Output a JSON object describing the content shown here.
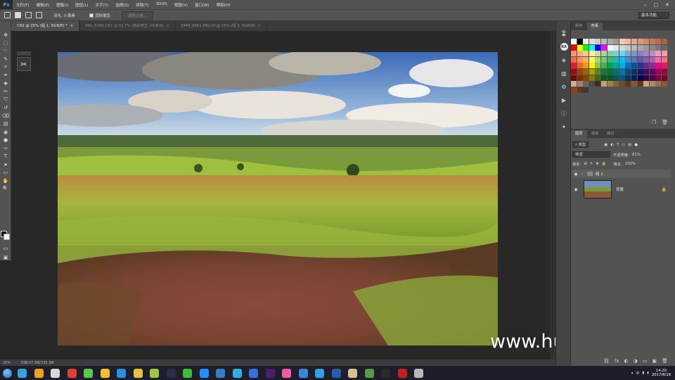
{
  "app": {
    "logo": "Ps"
  },
  "menu": [
    "文件(F)",
    "编辑(E)",
    "图像(I)",
    "图层(L)",
    "文字(Y)",
    "选择(S)",
    "滤镜(T)",
    "3D(D)",
    "视图(V)",
    "窗口(W)",
    "帮助(H)"
  ],
  "window_controls": [
    "–",
    "□",
    "✕"
  ],
  "options": {
    "feather_label": "羽化: 0 像素",
    "antialias_label": "消除锯齿",
    "refine_edge_label": "调整边缘...",
    "workspace": "基本功能"
  },
  "tabs": [
    {
      "label": "CR2 @ 25% (组 1, RGB/8) *",
      "active": true
    },
    {
      "label": "IMG_8399.CR2 @ 33.7% (色彩校正, RGB/8)",
      "active": false
    },
    {
      "label": "DMN_9981.HR2.tif @ 25% (组 1, RGB/8)",
      "active": false
    }
  ],
  "tool_icons": [
    "move-icon",
    "marquee-icon",
    "lasso-icon",
    "quick-select-icon",
    "crop-icon",
    "eyedropper-icon",
    "healing-icon",
    "brush-icon",
    "stamp-icon",
    "history-brush-icon",
    "eraser-icon",
    "gradient-icon",
    "blur-icon",
    "dodge-icon",
    "pen-icon",
    "type-icon",
    "path-select-icon",
    "shape-icon",
    "hand-icon",
    "zoom-icon"
  ],
  "tool_glyphs": [
    "✥",
    "⬚",
    "➰",
    "✎",
    "⌗",
    "✒",
    "✚",
    "✏",
    "⛉",
    "↺",
    "⌫",
    "▤",
    "◉",
    "●",
    "✑",
    "T",
    "➤",
    "▭",
    "✋",
    "🔍"
  ],
  "status": {
    "zoom": "25%",
    "doc": "文档:47.5M/233.3M"
  },
  "watermark": "www.hunls.com",
  "right_strip_icons": [
    "history-icon",
    "ra-icon",
    "properties-icon",
    "libraries-icon",
    "adjust-icon",
    "actions-icon",
    "info-icon",
    "color-sampler-icon"
  ],
  "right_strip_glyphs": [
    "⌛",
    "RA",
    "◈",
    "▥",
    "⚙",
    "▶",
    "ⓘ",
    "✦"
  ],
  "color_panel_tabs": [
    {
      "label": "颜色",
      "active": false
    },
    {
      "label": "色板",
      "active": true
    }
  ],
  "swatch_colors": [
    "#ffffff",
    "#000000",
    "#eeeeee",
    "#dddddd",
    "#cccccc",
    "#bbbbbb",
    "#aaaaaa",
    "#999999",
    "#f2c7b4",
    "#e8b9a0",
    "#dfa98c",
    "#d89a7a",
    "#cf8a68",
    "#c37b58",
    "#b76e4b",
    "#a8623f",
    "#ff0000",
    "#ffff00",
    "#00ff00",
    "#00ffff",
    "#0000ff",
    "#ff00ff",
    "#f5f5f5",
    "#e6e6e6",
    "#d6d6d6",
    "#c8c8c8",
    "#b8b8b8",
    "#a8a8a8",
    "#989898",
    "#888888",
    "#787878",
    "#686868",
    "#f7977a",
    "#f9ad81",
    "#fdc68a",
    "#fff79a",
    "#c4df9b",
    "#a2d39c",
    "#82ca9d",
    "#7bcdc8",
    "#6ecff6",
    "#7ea7d8",
    "#8493ca",
    "#8882be",
    "#a187be",
    "#bc8dbf",
    "#f49ac2",
    "#f6989d",
    "#f26c4f",
    "#f68e55",
    "#fbaf5c",
    "#fff467",
    "#acd372",
    "#7cc576",
    "#3bb878",
    "#1abbb4",
    "#00bff3",
    "#438ccb",
    "#5574b9",
    "#605ca8",
    "#855fa8",
    "#a763a8",
    "#f06ea9",
    "#f26d7d",
    "#ed1c24",
    "#f26522",
    "#f7941d",
    "#fff200",
    "#8dc73f",
    "#39b54a",
    "#00a651",
    "#00a99d",
    "#00aeef",
    "#0072bc",
    "#0054a6",
    "#2e3192",
    "#662d91",
    "#92278f",
    "#ec008c",
    "#ed145b",
    "#9e0b0f",
    "#a0410d",
    "#a36209",
    "#aba000",
    "#598527",
    "#1a7b30",
    "#007236",
    "#00746b",
    "#0076a3",
    "#004b80",
    "#003471",
    "#1b1464",
    "#440e62",
    "#630460",
    "#9e005d",
    "#9e0039",
    "#790000",
    "#7b2e00",
    "#7d4900",
    "#827b00",
    "#406618",
    "#005e20",
    "#005826",
    "#005952",
    "#005b7f",
    "#003663",
    "#002157",
    "#0d004c",
    "#32004b",
    "#4b0049",
    "#7b0046",
    "#7a0026",
    "#c7b299",
    "#998675",
    "#736357",
    "#534741",
    "#37302d",
    "#c69c6d",
    "#a67c52",
    "#8c6239",
    "#754c24",
    "#603913",
    "#8b5a2b",
    "#5e3c1a",
    "#cda97a",
    "#b08a5a",
    "#96724a",
    "#7e5c38",
    "#8b4513",
    "#6b3410",
    "#3a3a3a",
    "#535353",
    "#535353",
    "#535353",
    "#535353",
    "#535353",
    "#535353",
    "#535353",
    "#535353",
    "#535353",
    "#535353",
    "#535353",
    "#535353",
    "#535353"
  ],
  "layers_panel_tabs": [
    {
      "label": "图层",
      "active": true
    },
    {
      "label": "通道",
      "active": false
    },
    {
      "label": "路径",
      "active": false
    }
  ],
  "layers_controls": {
    "filter_kind": "类型",
    "blend_mode": "穿透",
    "opacity_label": "不透明度:",
    "opacity_value": "61%",
    "lock_label": "锁定:",
    "fill_label": "填充:",
    "fill_value": "100%"
  },
  "layers": [
    {
      "name": "组 1",
      "type": "group"
    },
    {
      "name": "背景",
      "type": "image",
      "locked": true
    }
  ],
  "layers_footer_icons": [
    "link-icon",
    "fx-icon",
    "mask-icon",
    "adjustment-icon",
    "group-icon",
    "new-layer-icon",
    "trash-icon"
  ],
  "layers_footer_glyphs": [
    "⛓",
    "fx",
    "◐",
    "◑",
    "▭",
    "▣",
    "🗑"
  ],
  "taskbar": {
    "apps": [
      "#3aa0e0",
      "#f0a020",
      "#d8d8d8",
      "#e04030",
      "#5cc84a",
      "#f0c030",
      "#2c8ee0",
      "#e8c040",
      "#9bc840",
      "#2b2b4a",
      "#3dbb3d",
      "#1e90ff",
      "#3a7dc4",
      "#2bb0e0",
      "#3c6fd8",
      "#4a1f6e",
      "#f05aa0",
      "#3a86d8",
      "#2f9fe0",
      "#2a5caa",
      "#d4c090",
      "#5a9a4a",
      "#2a2a2a",
      "#c02020",
      "#b8b8b8"
    ],
    "app_icons": [
      "qq-icon",
      "folder-icon",
      "player-icon",
      "weibo-icon",
      "wechat-icon",
      "chrome-icon",
      "cloud-icon",
      "bulb-icon",
      "browser-icon",
      "photoshop-icon",
      "browser2-icon",
      "ie-icon",
      "kugou-icon",
      "dropbox-icon",
      "kmplayer-icon",
      "premiere-icon",
      "color-app-icon",
      "heart-icon",
      "edge-icon",
      "word-icon",
      "explorer-icon",
      "profassor-icon",
      "recorder-icon",
      "record-icon",
      "misc-icon"
    ],
    "tray_text": "中",
    "time": "14:20",
    "date": "2017/8/18"
  }
}
